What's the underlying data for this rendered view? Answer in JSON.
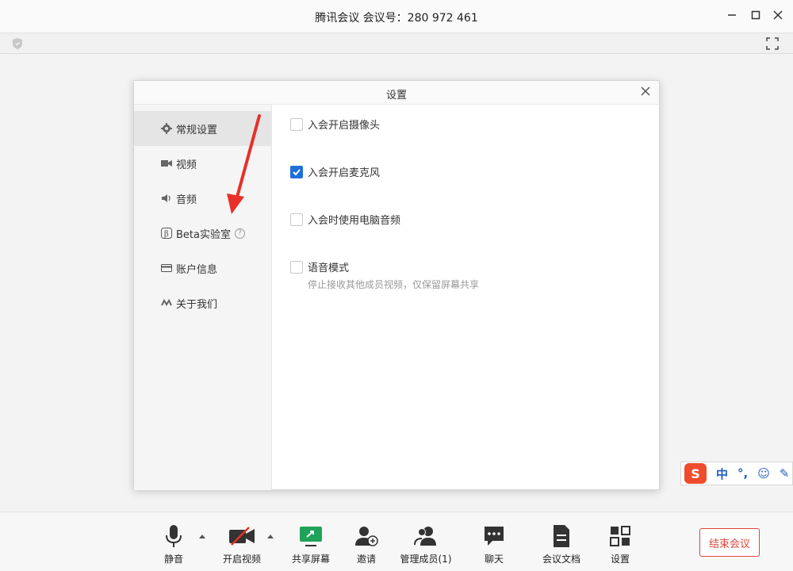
{
  "window": {
    "title": "腾讯会议 会议号：280 972 461",
    "controls": [
      "minimize-icon",
      "maximize-icon",
      "close-icon"
    ]
  },
  "dialog": {
    "title": "设置",
    "sidebar": [
      {
        "label": "常规设置",
        "icon": "gear-icon",
        "active": true
      },
      {
        "label": "视频",
        "icon": "camera-icon",
        "active": false
      },
      {
        "label": "音频",
        "icon": "speaker-icon",
        "active": false
      },
      {
        "label": "Beta实验室",
        "icon": "beta-icon",
        "active": false,
        "help": "?"
      },
      {
        "label": "账户信息",
        "icon": "card-icon",
        "active": false
      },
      {
        "label": "关于我们",
        "icon": "logo-icon",
        "active": false
      }
    ],
    "options": [
      {
        "label": "入会开启摄像头",
        "checked": false
      },
      {
        "label": "入会开启麦克风",
        "checked": true
      },
      {
        "label": "入会时使用电脑音频",
        "checked": false
      },
      {
        "label": "语音模式",
        "checked": false,
        "description": "停止接收其他成员视频，仅保留屏幕共享"
      }
    ]
  },
  "ime": {
    "logo": "S",
    "items": [
      "中",
      "°,",
      "☺",
      "✎"
    ]
  },
  "toolbar": {
    "items": [
      {
        "label": "静音",
        "icon": "microphone-icon"
      },
      {
        "label": "开启视频",
        "icon": "video-off-icon"
      },
      {
        "label": "共享屏幕",
        "icon": "share-screen-icon"
      },
      {
        "label": "邀请",
        "icon": "invite-icon"
      },
      {
        "label": "管理成员(1)",
        "icon": "members-icon"
      },
      {
        "label": "聊天",
        "icon": "chat-icon"
      },
      {
        "label": "会议文档",
        "icon": "document-icon"
      },
      {
        "label": "设置",
        "icon": "settings-icon"
      }
    ],
    "end_label": "结束会议"
  },
  "colors": {
    "accent": "#1e6fd9",
    "end": "#e0453a",
    "arrow": "#e8302a"
  }
}
